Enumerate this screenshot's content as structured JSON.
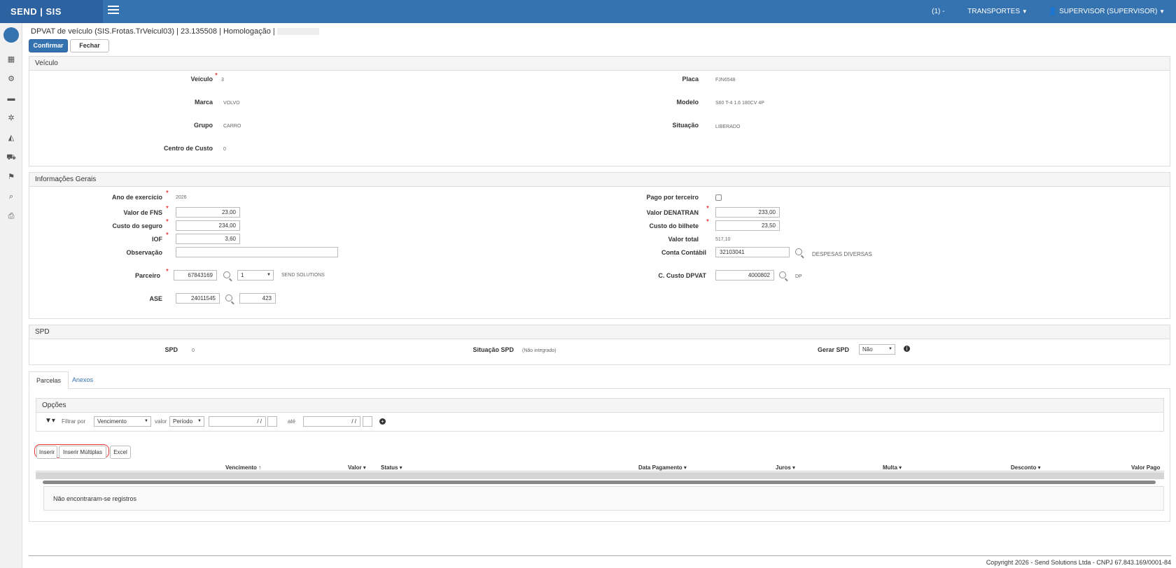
{
  "topbar": {
    "brand": "SEND | SIS",
    "company_prefix": "(1) -",
    "company": "TRANSPORTES",
    "user": "SUPERVISOR (SUPERVISOR)"
  },
  "page": {
    "title": "DPVAT de veículo (SIS.Frotas.TrVeicul03) | 23.135508 | Homologação |",
    "confirm_label": "Confirmar",
    "close_label": "Fechar"
  },
  "veiculo": {
    "header": "Veículo",
    "veiculo_label": "Veículo",
    "veiculo_value": "3",
    "placa_label": "Placa",
    "placa_value": "FJN6548",
    "marca_label": "Marca",
    "marca_value": "VOLVO",
    "modelo_label": "Modelo",
    "modelo_value": "S60 T-4 1.6 180CV 4P",
    "grupo_label": "Grupo",
    "grupo_value": "CARRO",
    "situacao_label": "Situação",
    "situacao_value": "LIBERADO",
    "centro_label": "Centro de Custo",
    "centro_value": "0"
  },
  "info": {
    "header": "Informações Gerais",
    "ano_label": "Ano de exercício",
    "ano_value": "2026",
    "pago_label": "Pago por terceiro",
    "fns_label": "Valor de FNS",
    "fns_value": "23,00",
    "denatran_label": "Valor DENATRAN",
    "denatran_value": "233,00",
    "seguro_label": "Custo do seguro",
    "seguro_value": "234,00",
    "bilhete_label": "Custo do bilhete",
    "bilhete_value": "23,50",
    "iof_label": "IOF",
    "iof_value": "3,60",
    "total_label": "Valor total",
    "total_value": "517,10",
    "obs_label": "Observação",
    "obs_value": "",
    "conta_label": "Conta Contábil",
    "conta_value": "32103041",
    "conta_desc": "DESPESAS DIVERSAS",
    "parceiro_label": "Parceiro",
    "parceiro_value": "67843169",
    "parceiro_select": "1",
    "parceiro_desc": "SEND SOLUTIONS",
    "ccusto_label": "C. Custo DPVAT",
    "ccusto_value": "4000802",
    "ccusto_desc": "DP",
    "ase_label": "ASE",
    "ase_value": "24011545",
    "ase_value2": "423"
  },
  "spd": {
    "header": "SPD",
    "spd_label": "SPD",
    "spd_value": "0",
    "situacao_label": "Situação SPD",
    "situacao_value": "(Não integrado)",
    "gerar_label": "Gerar SPD",
    "gerar_value": "Não"
  },
  "tabs": {
    "parcelas": "Parcelas",
    "anexos": "Anexos"
  },
  "opcoes": {
    "header": "Opções",
    "filtrar_label": "Filtrar por",
    "filtrar_value": "Vencimento",
    "valor_label": "valor",
    "valor_value": "Período",
    "date_mask1": "/ /",
    "ate_label": "até",
    "date_mask2": "/ /"
  },
  "actions": {
    "inserir": "Inserir",
    "inserir_multiplas": "Inserir Múltiplas",
    "excel": "Excel"
  },
  "table": {
    "columns": [
      "Vencimento",
      "Valor",
      "Status",
      "Data Pagamento",
      "Juros",
      "Multa",
      "Desconto",
      "Valor Pago"
    ],
    "empty": "Não encontraram-se registros"
  },
  "footer": "Copyright 2026 - Send Solutions Ltda - CNPJ 67.843.169/0001-84"
}
